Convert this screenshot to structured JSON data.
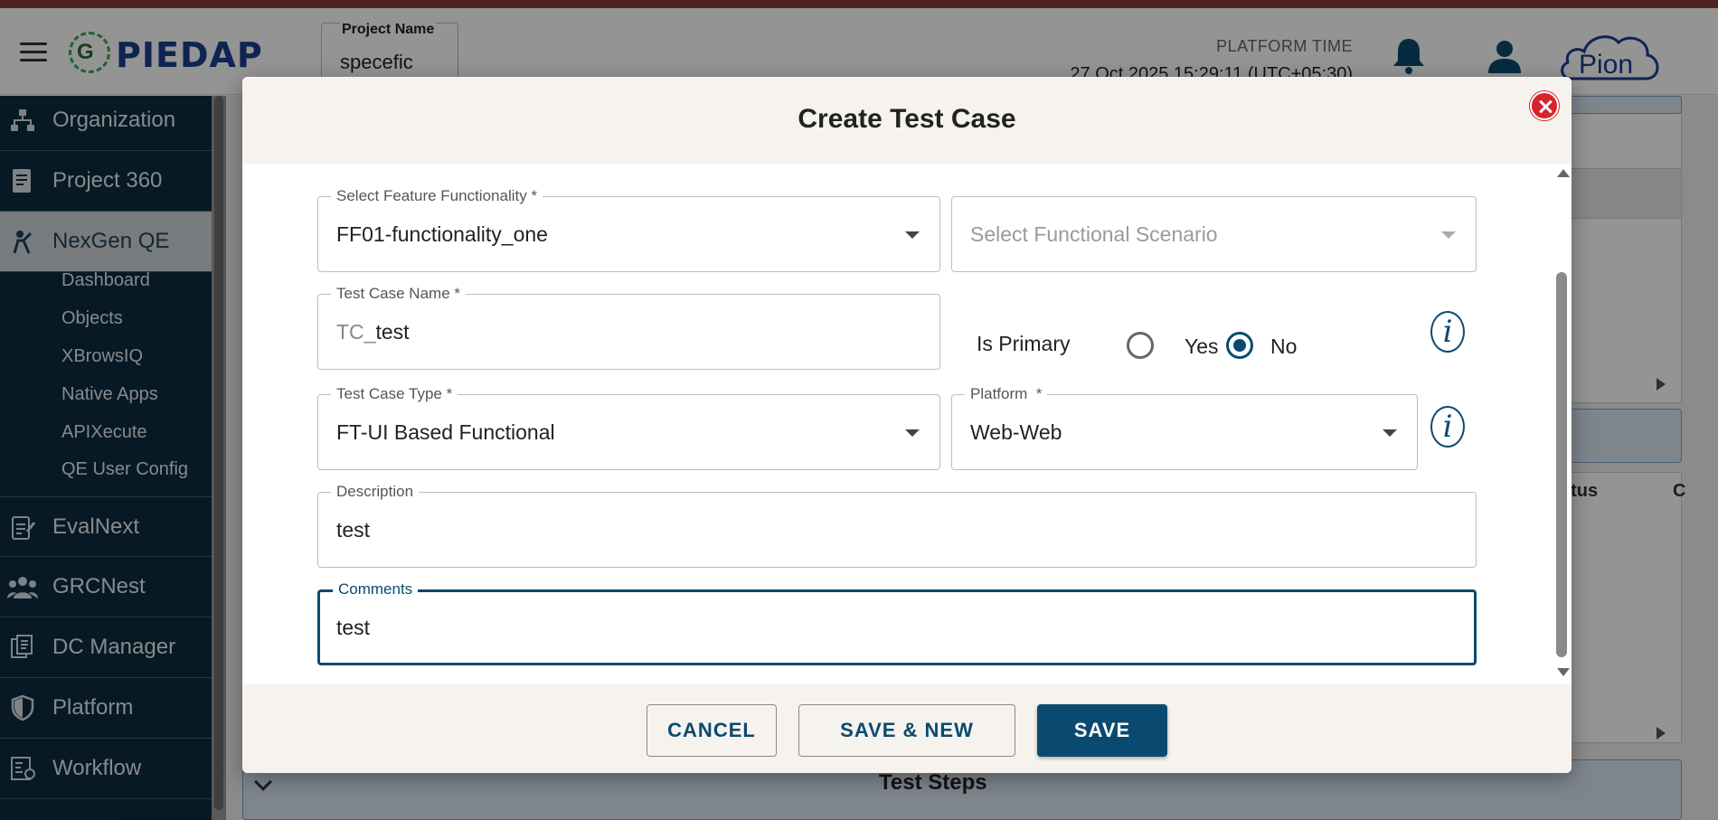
{
  "header": {
    "logo_text": "PIEDAP",
    "logo_mark": "G",
    "project_label": "Project Name",
    "project_value": "specefic",
    "platform_time_label": "PLATFORM TIME",
    "platform_time_value": "27 Oct 2025 15:29:11 (UTC+05:30)",
    "brand_logo": "Pion"
  },
  "sidebar": {
    "items": [
      {
        "label": "Organization",
        "icon": "organization-icon"
      },
      {
        "label": "Project 360",
        "icon": "project-icon"
      },
      {
        "label": "NexGen QE",
        "icon": "nexgen-icon"
      },
      {
        "label": "EvalNext",
        "icon": "evalnext-icon"
      },
      {
        "label": "GRCNest",
        "icon": "grcnest-icon"
      },
      {
        "label": "DC Manager",
        "icon": "dc-manager-icon"
      },
      {
        "label": "Platform",
        "icon": "shield-icon"
      },
      {
        "label": "Workflow",
        "icon": "workflow-icon"
      }
    ],
    "subitems": [
      "Dashboard",
      "Objects",
      "XBrowsIQ",
      "Native Apps",
      "APIXecute",
      "QE User Config"
    ]
  },
  "background": {
    "col_status": "atus",
    "col_next": "C",
    "test_steps": "Test Steps"
  },
  "dialog": {
    "title": "Create Test Case",
    "feature_label": "Select Feature Functionality *",
    "feature_value": "FF01-functionality_one",
    "scenario_placeholder": "Select Functional Scenario",
    "name_label": "Test Case Name *",
    "name_prefix": "TC_",
    "name_value": "test",
    "is_primary_label": "Is Primary",
    "yes_label": "Yes",
    "no_label": "No",
    "type_label": "Test Case Type *",
    "type_value": "FT-UI Based Functional",
    "platform_label": "Platform  *",
    "platform_value": "Web-Web",
    "description_label": "Description",
    "description_value": "test",
    "comments_label": "Comments",
    "comments_value": "test",
    "info_glyph": "i",
    "cancel_label": "CANCEL",
    "save_new_label": "SAVE & NEW",
    "save_label": "SAVE"
  },
  "colors": {
    "primary": "#0b4a70",
    "sidebar": "#0c2c3f",
    "close": "#d9232b"
  }
}
